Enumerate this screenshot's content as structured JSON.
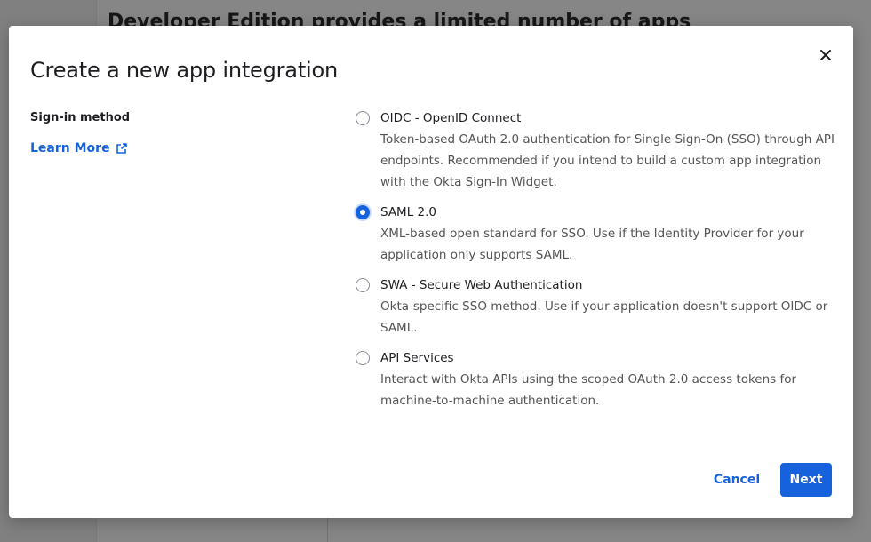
{
  "background": {
    "heading": "Developer Edition provides a limited number of apps"
  },
  "modal": {
    "title": "Create a new app integration",
    "close_icon": "close-icon",
    "section_label": "Sign-in method",
    "learn_more": "Learn More",
    "learn_more_icon": "external-link-icon",
    "selected_option": "SAML 2.0",
    "options": [
      {
        "label": "OIDC - OpenID Connect",
        "description": "Token-based OAuth 2.0 authentication for Single Sign-On (SSO) through API endpoints. Recommended if you intend to build a custom app integration with the Okta Sign-In Widget.",
        "checked": false
      },
      {
        "label": "SAML 2.0",
        "description": "XML-based open standard for SSO. Use if the Identity Provider for your application only supports SAML.",
        "checked": true
      },
      {
        "label": "SWA - Secure Web Authentication",
        "description": "Okta-specific SSO method. Use if your application doesn't support OIDC or SAML.",
        "checked": false
      },
      {
        "label": "API Services",
        "description": "Interact with Okta APIs using the scoped OAuth 2.0 access tokens for machine-to-machine authentication.",
        "checked": false
      }
    ],
    "cancel_label": "Cancel",
    "next_label": "Next"
  },
  "colors": {
    "accent": "#1662dd",
    "text": "#1d1d21",
    "muted": "#545457"
  }
}
